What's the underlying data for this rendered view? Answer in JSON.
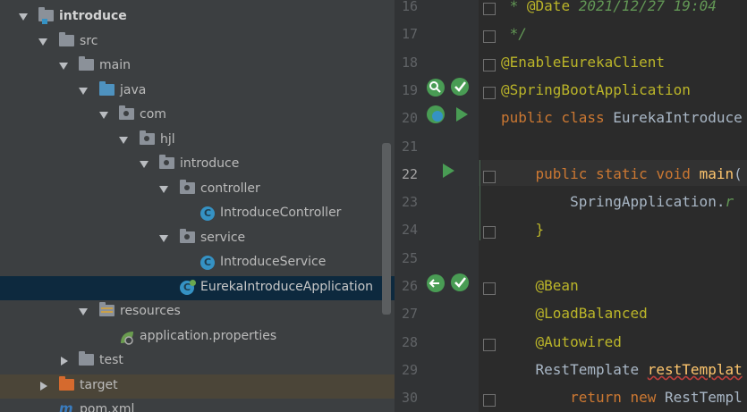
{
  "tree": {
    "items": [
      {
        "label": "introduce",
        "bold": true
      },
      {
        "label": "src"
      },
      {
        "label": "main"
      },
      {
        "label": "java"
      },
      {
        "label": "com"
      },
      {
        "label": "hjl"
      },
      {
        "label": "introduce"
      },
      {
        "label": "controller"
      },
      {
        "label": "IntroduceController"
      },
      {
        "label": "service"
      },
      {
        "label": "IntroduceService"
      },
      {
        "label": "EurekaIntroduceApplication"
      },
      {
        "label": "resources"
      },
      {
        "label": "application.properties"
      },
      {
        "label": "test"
      },
      {
        "label": "target"
      },
      {
        "label": "pom.xml"
      }
    ]
  },
  "editor": {
    "lines": [
      {
        "num": "16",
        "parts": [
          [
            "cmt",
            " * "
          ],
          [
            "ann",
            "@Date"
          ],
          [
            "cmt",
            " 2021/12/27 19:04"
          ]
        ]
      },
      {
        "num": "17",
        "parts": [
          [
            "cmt",
            " */"
          ]
        ]
      },
      {
        "num": "18",
        "parts": [
          [
            "ann",
            "@EnableEurekaClient"
          ]
        ]
      },
      {
        "num": "19",
        "parts": [
          [
            "ann",
            "@SpringBootApplication"
          ]
        ]
      },
      {
        "num": "20",
        "parts": [
          [
            "kw",
            "public class "
          ],
          [
            "plain",
            "EurekaIntroduce"
          ]
        ]
      },
      {
        "num": "21",
        "parts": []
      },
      {
        "num": "22",
        "parts": [
          [
            "plain",
            "    "
          ],
          [
            "kw",
            "public static void "
          ],
          [
            "meth",
            "main"
          ],
          [
            "plain",
            "("
          ]
        ]
      },
      {
        "num": "23",
        "parts": [
          [
            "plain",
            "        SpringApplication."
          ],
          [
            "cmt",
            "r"
          ]
        ]
      },
      {
        "num": "24",
        "parts": [
          [
            "plain",
            "    "
          ],
          [
            "ann",
            "}"
          ]
        ]
      },
      {
        "num": "25",
        "parts": []
      },
      {
        "num": "26",
        "parts": [
          [
            "plain",
            "    "
          ],
          [
            "ann",
            "@Bean"
          ]
        ]
      },
      {
        "num": "27",
        "parts": [
          [
            "plain",
            "    "
          ],
          [
            "ann",
            "@LoadBalanced"
          ]
        ]
      },
      {
        "num": "28",
        "parts": [
          [
            "plain",
            "    "
          ],
          [
            "ann",
            "@Autowired"
          ]
        ]
      },
      {
        "num": "29",
        "parts": [
          [
            "plain",
            "    RestTemplate "
          ],
          [
            "err",
            "restTemplat"
          ]
        ]
      },
      {
        "num": "30",
        "parts": [
          [
            "plain",
            "        "
          ],
          [
            "kw",
            "return new "
          ],
          [
            "plain",
            "RestTempl"
          ]
        ]
      }
    ]
  }
}
